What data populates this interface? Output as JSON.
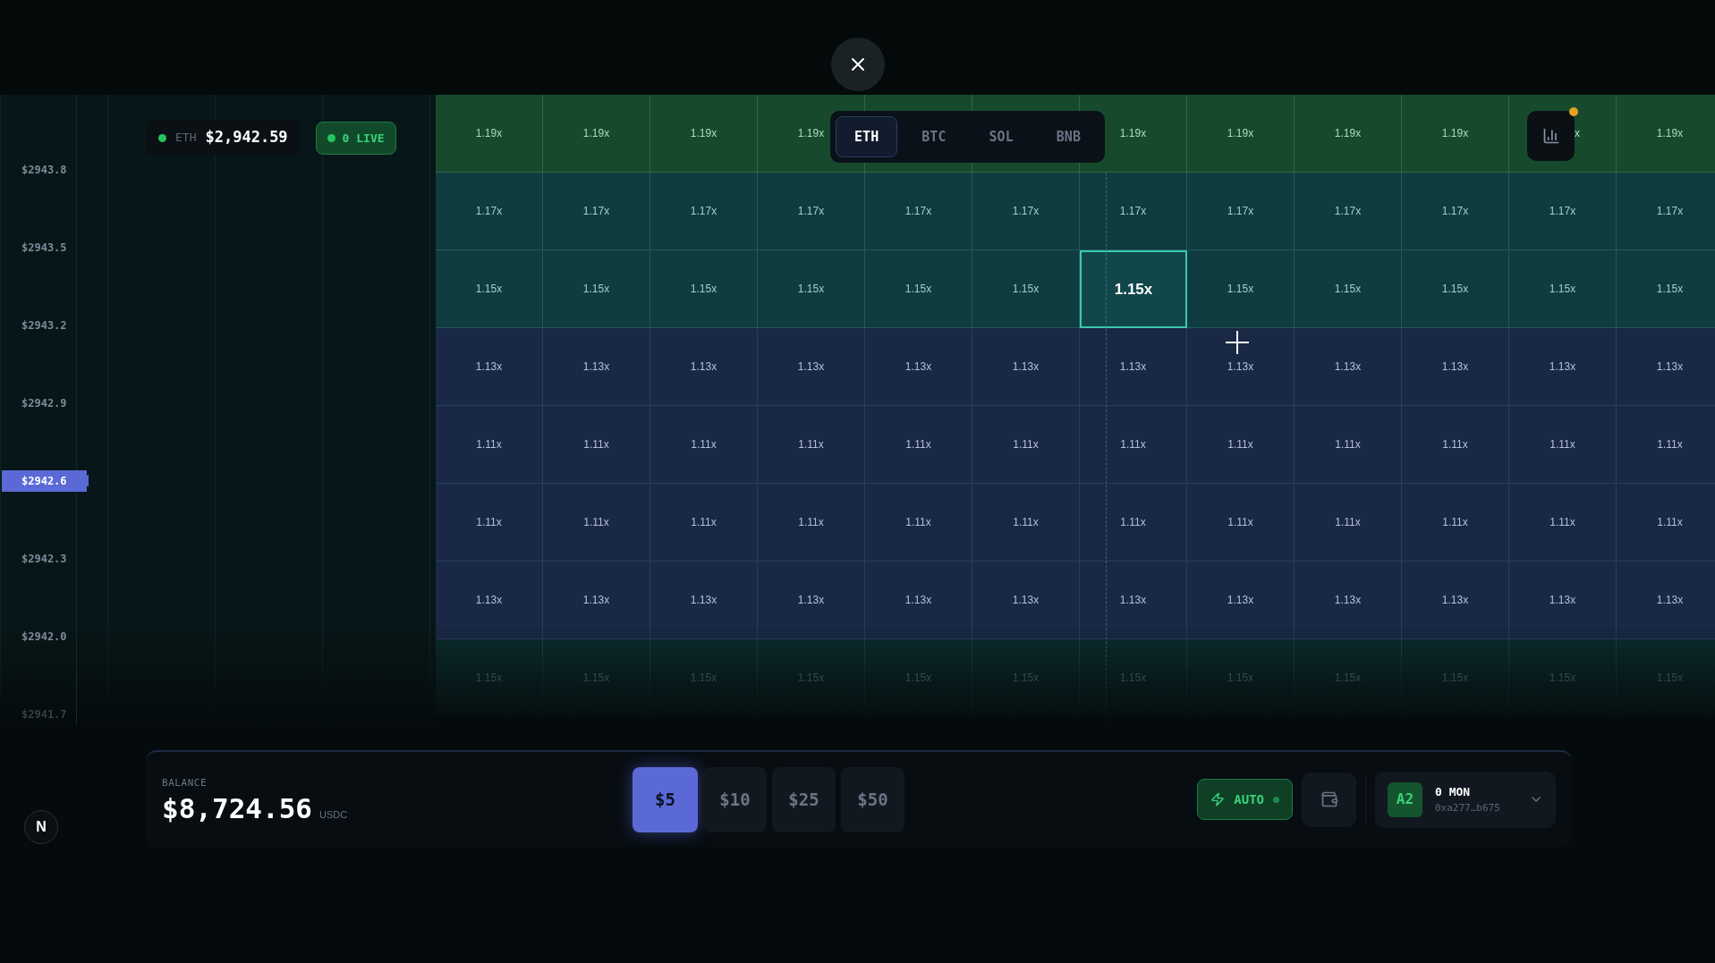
{
  "ticker": {
    "symbol": "ETH",
    "price": "$2,942.59",
    "live": "0 LIVE"
  },
  "axis": [
    {
      "label": "$2943.8",
      "current": false,
      "dim": false
    },
    {
      "label": "$2943.5",
      "current": false,
      "dim": false
    },
    {
      "label": "$2943.2",
      "current": false,
      "dim": false
    },
    {
      "label": "$2942.9",
      "current": false,
      "dim": false
    },
    {
      "label": "$2942.6",
      "current": true,
      "dim": false
    },
    {
      "label": "$2942.3",
      "current": false,
      "dim": false
    },
    {
      "label": "$2942.0",
      "current": false,
      "dim": false
    },
    {
      "label": "$2941.7",
      "current": false,
      "dim": true
    }
  ],
  "assets": [
    {
      "label": "ETH",
      "selected": true
    },
    {
      "label": "BTC",
      "selected": false
    },
    {
      "label": "SOL",
      "selected": false
    },
    {
      "label": "BNB",
      "selected": false
    }
  ],
  "chart_button": {
    "alert": true
  },
  "grid": {
    "rows": [
      {
        "kind": "green",
        "cells": [
          {
            "label": "1.19x",
            "selected": false
          },
          {
            "label": "1.19x",
            "selected": false
          },
          {
            "label": "1.19x",
            "selected": false
          },
          {
            "label": "1.19x",
            "selected": false
          },
          "",
          "",
          {
            "label": "1.19x",
            "selected": false
          },
          {
            "label": "1.19x",
            "selected": false
          },
          {
            "label": "1.19x",
            "selected": false
          },
          {
            "label": "1.19x",
            "selected": false
          },
          {
            "label": "x",
            "selected": false,
            "clipped": true
          },
          {
            "label": "1.19x",
            "selected": false
          }
        ]
      },
      {
        "kind": "teal",
        "cells": [
          {
            "label": "1.17x",
            "selected": false
          },
          {
            "label": "1.17x",
            "selected": false
          },
          {
            "label": "1.17x",
            "selected": false
          },
          {
            "label": "1.17x",
            "selected": false
          },
          {
            "label": "1.17x",
            "selected": false
          },
          {
            "label": "1.17x",
            "selected": false
          },
          {
            "label": "1.17x",
            "selected": false
          },
          {
            "label": "1.17x",
            "selected": false
          },
          {
            "label": "1.17x",
            "selected": false
          },
          {
            "label": "1.17x",
            "selected": false
          },
          {
            "label": "1.17x",
            "selected": false
          },
          {
            "label": "1.17x",
            "selected": false
          }
        ]
      },
      {
        "kind": "teal",
        "cells": [
          {
            "label": "1.15x",
            "selected": false
          },
          {
            "label": "1.15x",
            "selected": false
          },
          {
            "label": "1.15x",
            "selected": false
          },
          {
            "label": "1.15x",
            "selected": false
          },
          {
            "label": "1.15x",
            "selected": false
          },
          {
            "label": "1.15x",
            "selected": false
          },
          {
            "label": "1.15x",
            "selected": true
          },
          {
            "label": "1.15x",
            "selected": false
          },
          {
            "label": "1.15x",
            "selected": false
          },
          {
            "label": "1.15x",
            "selected": false
          },
          {
            "label": "1.15x",
            "selected": false
          },
          {
            "label": "1.15x",
            "selected": false
          }
        ]
      },
      {
        "kind": "navy",
        "cells": [
          {
            "label": "1.13x",
            "selected": false
          },
          {
            "label": "1.13x",
            "selected": false
          },
          {
            "label": "1.13x",
            "selected": false
          },
          {
            "label": "1.13x",
            "selected": false
          },
          {
            "label": "1.13x",
            "selected": false
          },
          {
            "label": "1.13x",
            "selected": false
          },
          {
            "label": "1.13x",
            "selected": false
          },
          {
            "label": "1.13x",
            "selected": false
          },
          {
            "label": "1.13x",
            "selected": false
          },
          {
            "label": "1.13x",
            "selected": false
          },
          {
            "label": "1.13x",
            "selected": false
          },
          {
            "label": "1.13x",
            "selected": false
          }
        ]
      },
      {
        "kind": "navy",
        "cells": [
          {
            "label": "1.11x",
            "selected": false
          },
          {
            "label": "1.11x",
            "selected": false
          },
          {
            "label": "1.11x",
            "selected": false
          },
          {
            "label": "1.11x",
            "selected": false
          },
          {
            "label": "1.11x",
            "selected": false
          },
          {
            "label": "1.11x",
            "selected": false
          },
          {
            "label": "1.11x",
            "selected": false
          },
          {
            "label": "1.11x",
            "selected": false
          },
          {
            "label": "1.11x",
            "selected": false
          },
          {
            "label": "1.11x",
            "selected": false
          },
          {
            "label": "1.11x",
            "selected": false
          },
          {
            "label": "1.11x",
            "selected": false
          }
        ]
      },
      {
        "kind": "navy",
        "cells": [
          {
            "label": "1.11x",
            "selected": false
          },
          {
            "label": "1.11x",
            "selected": false
          },
          {
            "label": "1.11x",
            "selected": false
          },
          {
            "label": "1.11x",
            "selected": false
          },
          {
            "label": "1.11x",
            "selected": false
          },
          {
            "label": "1.11x",
            "selected": false
          },
          {
            "label": "1.11x",
            "selected": false
          },
          {
            "label": "1.11x",
            "selected": false
          },
          {
            "label": "1.11x",
            "selected": false
          },
          {
            "label": "1.11x",
            "selected": false
          },
          {
            "label": "1.11x",
            "selected": false
          },
          {
            "label": "1.11x",
            "selected": false
          }
        ]
      },
      {
        "kind": "navy",
        "cells": [
          {
            "label": "1.13x",
            "selected": false
          },
          {
            "label": "1.13x",
            "selected": false
          },
          {
            "label": "1.13x",
            "selected": false
          },
          {
            "label": "1.13x",
            "selected": false
          },
          {
            "label": "1.13x",
            "selected": false
          },
          {
            "label": "1.13x",
            "selected": false
          },
          {
            "label": "1.13x",
            "selected": false
          },
          {
            "label": "1.13x",
            "selected": false
          },
          {
            "label": "1.13x",
            "selected": false
          },
          {
            "label": "1.13x",
            "selected": false
          },
          {
            "label": "1.13x",
            "selected": false
          },
          {
            "label": "1.13x",
            "selected": false
          }
        ]
      },
      {
        "kind": "fade",
        "cells": [
          {
            "label": "1.15x",
            "selected": false
          },
          {
            "label": "1.15x",
            "selected": false
          },
          {
            "label": "1.15x",
            "selected": false
          },
          {
            "label": "1.15x",
            "selected": false
          },
          {
            "label": "1.15x",
            "selected": false
          },
          {
            "label": "1.15x",
            "selected": false
          },
          {
            "label": "1.15x",
            "selected": false
          },
          {
            "label": "1.15x",
            "selected": false
          },
          {
            "label": "1.15x",
            "selected": false
          },
          {
            "label": "1.15x",
            "selected": false
          },
          {
            "label": "1.15x",
            "selected": false
          },
          {
            "label": "1.15x",
            "selected": false
          }
        ]
      }
    ]
  },
  "logo": {
    "letter": "N"
  },
  "balance": {
    "label": "BALANCE",
    "amount": "$8,724.56",
    "unit": "USDC"
  },
  "amounts": [
    {
      "label": "$5",
      "selected": true
    },
    {
      "label": "$10",
      "selected": false
    },
    {
      "label": "$25",
      "selected": false
    },
    {
      "label": "$50",
      "selected": false
    }
  ],
  "auto": {
    "label": "AUTO",
    "on": true
  },
  "account": {
    "avatar": "A2",
    "name": "0 MON",
    "address": "0xa277…b675"
  }
}
